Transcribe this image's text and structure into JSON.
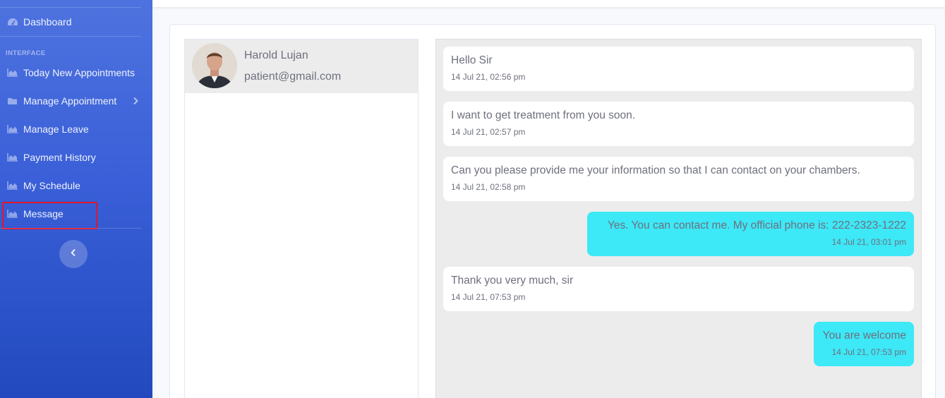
{
  "sidebar": {
    "dashboard": "Dashboard",
    "heading": "INTERFACE",
    "items": [
      {
        "label": "Today New Appointments",
        "icon": "chart-area-icon"
      },
      {
        "label": "Manage Appointment",
        "icon": "folder-icon"
      },
      {
        "label": "Manage Leave",
        "icon": "chart-area-icon"
      },
      {
        "label": "Payment History",
        "icon": "chart-area-icon"
      },
      {
        "label": "My Schedule",
        "icon": "chart-area-icon"
      },
      {
        "label": "Message",
        "icon": "chart-area-icon"
      }
    ],
    "highlight_color": "#e0162b"
  },
  "contact": {
    "name": "Harold Lujan",
    "email": "patient@gmail.com"
  },
  "messages": [
    {
      "text": "Hello Sir",
      "time": "14 Jul 21, 02:56 pm",
      "direction": "in"
    },
    {
      "text": "I want to get treatment from you soon.",
      "time": "14 Jul 21, 02:57 pm",
      "direction": "in"
    },
    {
      "text": "Can you please provide me your information so that I can contact on your chambers.",
      "time": "14 Jul 21, 02:58 pm",
      "direction": "in"
    },
    {
      "text": "Yes. You can contact me. My official phone is: 222-2323-1222",
      "time": "14 Jul 21, 03:01 pm",
      "direction": "out"
    },
    {
      "text": "Thank you very much, sir",
      "time": "14 Jul 21, 07:53 pm",
      "direction": "in"
    },
    {
      "text": "You are welcome",
      "time": "14 Jul 21, 07:53 pm",
      "direction": "out"
    }
  ],
  "colors": {
    "sidebar_top": "#4e73df",
    "sidebar_bottom": "#224abe",
    "outgoing_bubble": "#3de8f7",
    "incoming_bubble": "#ffffff",
    "chat_background": "#ececec"
  }
}
